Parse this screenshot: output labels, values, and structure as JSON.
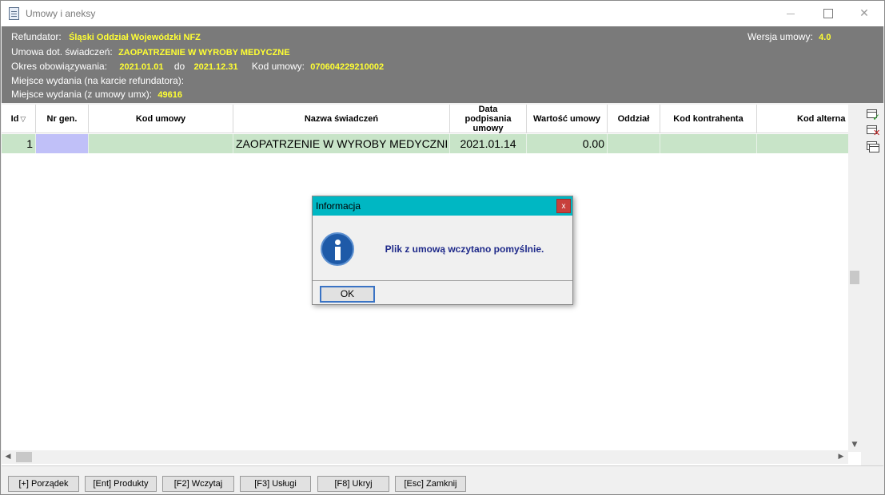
{
  "window": {
    "title": "Umowy i aneksy"
  },
  "header": {
    "refundator_label": "Refundator:",
    "refundator_value": "Śląski Oddział Wojewódzki NFZ",
    "version_label": "Wersja umowy:",
    "version_value": "4.0",
    "service_label": "Umowa dot. świadczeń:",
    "service_value": "ZAOPATRZENIE W WYROBY MEDYCZNE",
    "period_label": "Okres obowiązywania:",
    "period_from": "2021.01.01",
    "period_to_label": "do",
    "period_to": "2021.12.31",
    "contract_code_label": "Kod umowy:",
    "contract_code_value": "070604229210002",
    "issue_place_refundator_label": "Miejsce wydania (na karcie refundatora):",
    "issue_place_umx_label": "Miejsce wydania (z umowy umx):",
    "issue_place_umx_value": "49616"
  },
  "table": {
    "columns": [
      "Id",
      "Nr gen.",
      "Kod umowy",
      "Nazwa świadczeń",
      "Data podpisania umowy",
      "Wartość umowy",
      "Oddział",
      "Kod kontrahenta",
      "Kod alterna"
    ],
    "sort_indicator": "▽",
    "rows": [
      {
        "id": "1",
        "nr_gen": "",
        "kod_umowy": "",
        "nazwa": "ZAOPATRZENIE W WYROBY MEDYCZNI",
        "data": "2021.01.14",
        "wartosc": "0.00",
        "oddzial": "",
        "kod_kontrahenta": "",
        "kod_alterna": ""
      }
    ]
  },
  "bottom_buttons": [
    "[+] Porządek",
    "[Ent] Produkty",
    "[F2] Wczytaj",
    "[F3] Usługi",
    "[F8] Ukryj",
    "[Esc] Zamknij"
  ],
  "dialog": {
    "title": "Informacja",
    "close_label": "x",
    "message": "Plik z umową wczytano pomyślnie.",
    "ok_label": "OK"
  },
  "colors": {
    "header_bg": "#7a7a7a",
    "header_value": "#ffff33",
    "row_selected": "#c8e4c8",
    "nr_gen_cell": "#c0c0f8",
    "dialog_title_bg": "#00b7c3",
    "dialog_close_bg": "#c8403c"
  }
}
